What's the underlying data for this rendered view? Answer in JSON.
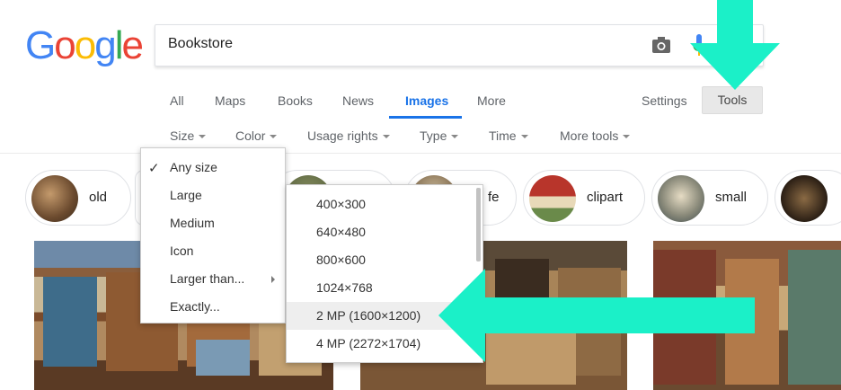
{
  "logo": {
    "letters": [
      "G",
      "o",
      "o",
      "g",
      "l",
      "e"
    ]
  },
  "search": {
    "value": "Bookstore"
  },
  "nav": {
    "all": "All",
    "maps": "Maps",
    "books": "Books",
    "news": "News",
    "images": "Images",
    "more": "More",
    "settings": "Settings",
    "tools": "Tools"
  },
  "toolbar": {
    "size": "Size",
    "color": "Color",
    "usage_rights": "Usage rights",
    "type": "Type",
    "time": "Time",
    "more_tools": "More tools"
  },
  "chips": {
    "c1": "old",
    "c2": "fe",
    "c3": "clipart",
    "c4": "small"
  },
  "size_menu": {
    "check": "✓",
    "any_size": "Any size",
    "large": "Large",
    "medium": "Medium",
    "icon": "Icon",
    "larger_than": "Larger than...",
    "exactly": "Exactly..."
  },
  "larger_than_menu": {
    "o1": "400×300",
    "o2": "640×480",
    "o3": "800×600",
    "o4": "1024×768",
    "o5": "2 MP (1600×1200)",
    "o6": "4 MP (2272×1704)"
  },
  "colors": {
    "arrow": "#1BF0C8",
    "accent": "#1a73e8"
  }
}
